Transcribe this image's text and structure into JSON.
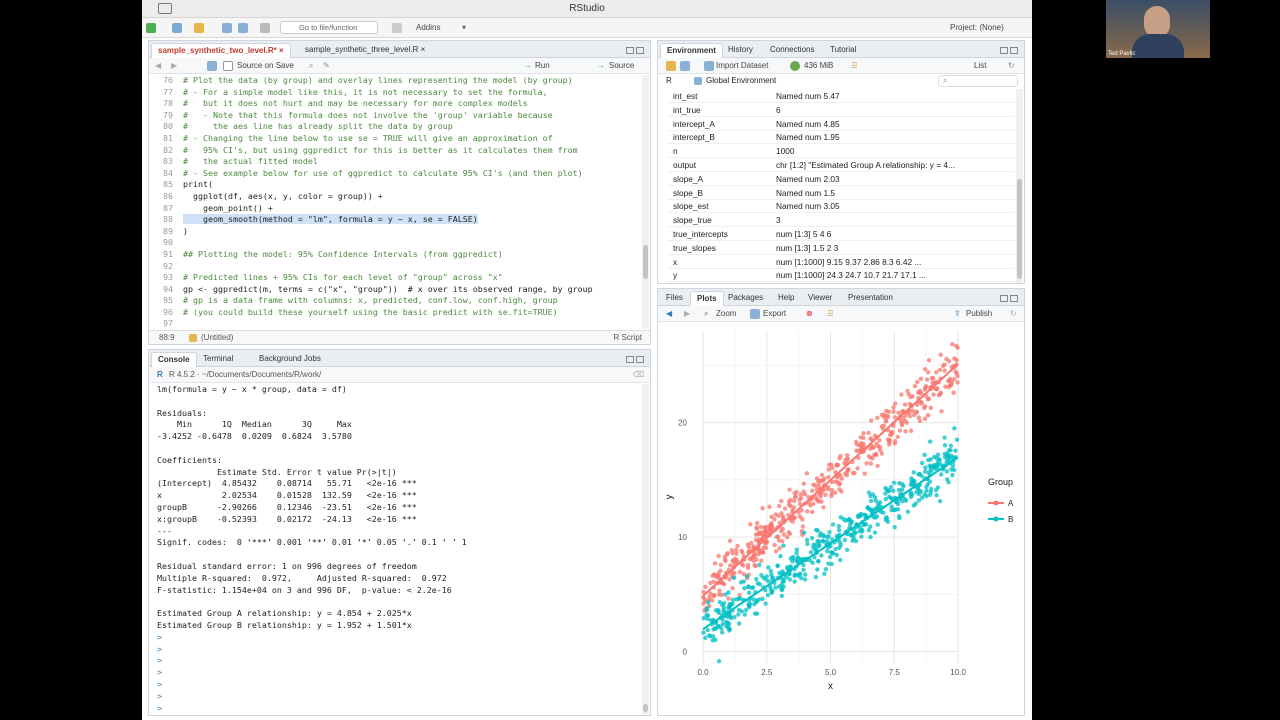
{
  "app": {
    "title": "RStudio",
    "project": "Project: (None)"
  },
  "toolbar": {
    "goto_placeholder": "Go to file/function",
    "addins": "Addins"
  },
  "editor": {
    "tabs": [
      "sample_synthetic_two_level.R*",
      "sample_synthetic_three_level.R"
    ],
    "source_on_save": "Source on Save",
    "run": "Run",
    "source": "Source",
    "lines": [
      {
        "n": "76",
        "t": "# Plot the data (by group) and overlay lines representing the model (by group)",
        "c": "cm"
      },
      {
        "n": "77",
        "t": "# - For a simple model like this, it is not necessary to set the formula,",
        "c": "cm"
      },
      {
        "n": "78",
        "t": "#   but it does not hurt and may be necessary for more complex models",
        "c": "cm"
      },
      {
        "n": "79",
        "t": "#   - Note that this formula does not involve the 'group' variable because",
        "c": "cm"
      },
      {
        "n": "80",
        "t": "#     the aes line has already split the data by group",
        "c": "cm"
      },
      {
        "n": "81",
        "t": "# - Changing the line below to use se = TRUE will give an approximation of",
        "c": "cm"
      },
      {
        "n": "82",
        "t": "#   95% CI's, but using ggpredict for this is better as it calculates them from",
        "c": "cm"
      },
      {
        "n": "83",
        "t": "#   the actual fitted model",
        "c": "cm"
      },
      {
        "n": "84",
        "t": "# - See example below for use of ggpredict to calculate 95% CI's (and then plot)",
        "c": "cm"
      },
      {
        "n": "85",
        "t": "print(",
        "c": ""
      },
      {
        "n": "86",
        "t": "  ggplot(df, aes(x, y, color = group)) +",
        "c": ""
      },
      {
        "n": "87",
        "t": "    geom_point() +",
        "c": ""
      },
      {
        "n": "88",
        "t": "    geom_smooth(method = \"lm\", formula = y ~ x, se = FALSE)",
        "c": "hl"
      },
      {
        "n": "89",
        "t": ")",
        "c": ""
      },
      {
        "n": "90",
        "t": "",
        "c": ""
      },
      {
        "n": "91",
        "t": "## Plotting the model: 95% Confidence Intervals (from ggpredict)",
        "c": "cm"
      },
      {
        "n": "92",
        "t": "",
        "c": ""
      },
      {
        "n": "93",
        "t": "# Predicted lines + 95% CIs for each level of \"group\" across \"x\"",
        "c": "cm"
      },
      {
        "n": "94",
        "t": "gp <- ggpredict(m, terms = c(\"x\", \"group\"))  # x over its observed range, by group",
        "c": ""
      },
      {
        "n": "95",
        "t": "# gp is a data frame with columns: x, predicted, conf.low, conf.high, group",
        "c": "cm"
      },
      {
        "n": "96",
        "t": "# (you could build these yourself using the basic predict with se.fit=TRUE)",
        "c": "cm"
      },
      {
        "n": "97",
        "t": "",
        "c": ""
      }
    ],
    "status_pos": "88:9",
    "status_scope": "(Untitled)",
    "status_type": "R Script"
  },
  "console": {
    "tabs": [
      "Console",
      "Terminal",
      "Background Jobs"
    ],
    "path": "R 4.5.2 · ~/Documents/Documents/R/work/",
    "lines": [
      "lm(formula = y ~ x * group, data = df)",
      "",
      "Residuals:",
      "    Min      1Q  Median      3Q     Max ",
      "-3.4252 -0.6478  0.0209  0.6824  3.5780 ",
      "",
      "Coefficients:",
      "            Estimate Std. Error t value Pr(>|t|)    ",
      "(Intercept)  4.85432    0.08714   55.71   <2e-16 ***",
      "x            2.02534    0.01528  132.59   <2e-16 ***",
      "groupB      -2.90266    0.12346  -23.51   <2e-16 ***",
      "x:groupB    -0.52393    0.02172  -24.13   <2e-16 ***",
      "---",
      "Signif. codes:  0 ‘***’ 0.001 ‘**’ 0.01 ‘*’ 0.05 ‘.’ 0.1 ‘ ’ 1",
      "",
      "Residual standard error: 1 on 996 degrees of freedom",
      "Multiple R-squared:  0.972,\tAdjusted R-squared:  0.972 ",
      "F-statistic: 1.154e+04 on 3 and 996 DF,  p-value: < 2.2e-16",
      "",
      "Estimated Group A relationship: y = 4.854 + 2.025*x",
      "Estimated Group B relationship: y = 1.952 + 1.501*x",
      ">",
      ">",
      ">",
      ">",
      ">",
      ">",
      "> "
    ]
  },
  "env": {
    "tabs": [
      "Environment",
      "History",
      "Connections",
      "Tutorial"
    ],
    "import": "Import Dataset",
    "memory": "436 MiB",
    "list": "List",
    "lang": "R",
    "scope": "Global Environment",
    "rows": [
      {
        "k": "int_est",
        "v": "Named num 5.47"
      },
      {
        "k": "int_true",
        "v": "6"
      },
      {
        "k": "intercept_A",
        "v": "Named num 4.85"
      },
      {
        "k": "intercept_B",
        "v": "Named num 1.95"
      },
      {
        "k": "n",
        "v": "1000"
      },
      {
        "k": "output",
        "v": "chr [1:2] \"Estimated Group A relationship: y = 4..."
      },
      {
        "k": "slope_A",
        "v": "Named num 2.03"
      },
      {
        "k": "slope_B",
        "v": "Named num 1.5"
      },
      {
        "k": "slope_est",
        "v": "Named num 3.05"
      },
      {
        "k": "slope_true",
        "v": "3"
      },
      {
        "k": "true_intercepts",
        "v": "num [1:3] 5 4 6"
      },
      {
        "k": "true_slopes",
        "v": "num [1:3] 1.5 2 3"
      },
      {
        "k": "x",
        "v": "num [1:1000] 9.15 9.37 2.86 8.3 6.42 ..."
      },
      {
        "k": "y",
        "v": "num [1:1000] 24.3 24.7 10.7 21.7 17.1 ..."
      }
    ]
  },
  "plots": {
    "tabs": [
      "Files",
      "Plots",
      "Packages",
      "Help",
      "Viewer",
      "Presentation"
    ],
    "zoom": "Zoom",
    "export": "Export",
    "publish": "Publish"
  },
  "chart_data": {
    "type": "scatter",
    "xlabel": "x",
    "ylabel": "y",
    "xlim": [
      0,
      10
    ],
    "ylim": [
      -1,
      28
    ],
    "xticks": [
      "0.0",
      "2.5",
      "5.0",
      "7.5",
      "10.0"
    ],
    "yticks": [
      "0",
      "10",
      "20"
    ],
    "legend_title": "Group",
    "legend_position": "right",
    "series": [
      {
        "name": "A",
        "color": "#F8766D",
        "intercept": 4.854,
        "slope": 2.025
      },
      {
        "name": "B",
        "color": "#00BFC4",
        "intercept": 1.952,
        "slope": 1.501
      }
    ]
  },
  "presenter": {
    "name": "Ted Pavlic"
  },
  "colors": {
    "accent": "#2d7bb8",
    "comment": "#4b8a3e",
    "A": "#F8766D",
    "B": "#00BFC4"
  }
}
